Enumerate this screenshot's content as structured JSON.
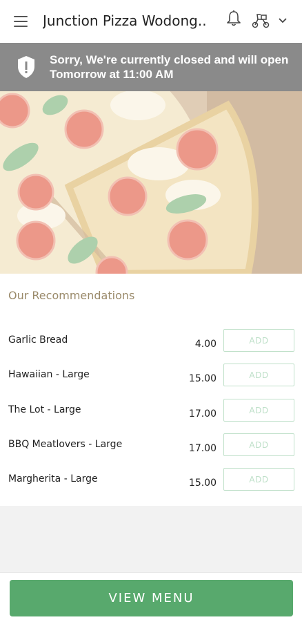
{
  "header": {
    "title": "Junction Pizza Wodong..",
    "icons": [
      "menu-icon",
      "bell-icon",
      "delivery-scooter-icon",
      "chevron-down-icon"
    ]
  },
  "banner": {
    "message": "Sorry, We're currently closed and will open Tomorrow at 11:00 AM",
    "icon": "shield-alert-icon"
  },
  "hero": {
    "image": "pizza-photo"
  },
  "recommendations": {
    "heading": "Our Recommendations",
    "items": [
      {
        "name": "Garlic Bread",
        "price": "4.00",
        "action": "ADD"
      },
      {
        "name": "Hawaiian - Large",
        "price": "15.00",
        "action": "ADD"
      },
      {
        "name": "The Lot - Large",
        "price": "17.00",
        "action": "ADD"
      },
      {
        "name": "BBQ Meatlovers - Large",
        "price": "17.00",
        "action": "ADD"
      },
      {
        "name": "Margherita - Large",
        "price": "15.00",
        "action": "ADD"
      }
    ]
  },
  "footer": {
    "button_label": "VIEW MENU"
  },
  "colors": {
    "accent": "#58a96d",
    "banner": "#8a8a8a",
    "heading": "#9a8a6a"
  }
}
